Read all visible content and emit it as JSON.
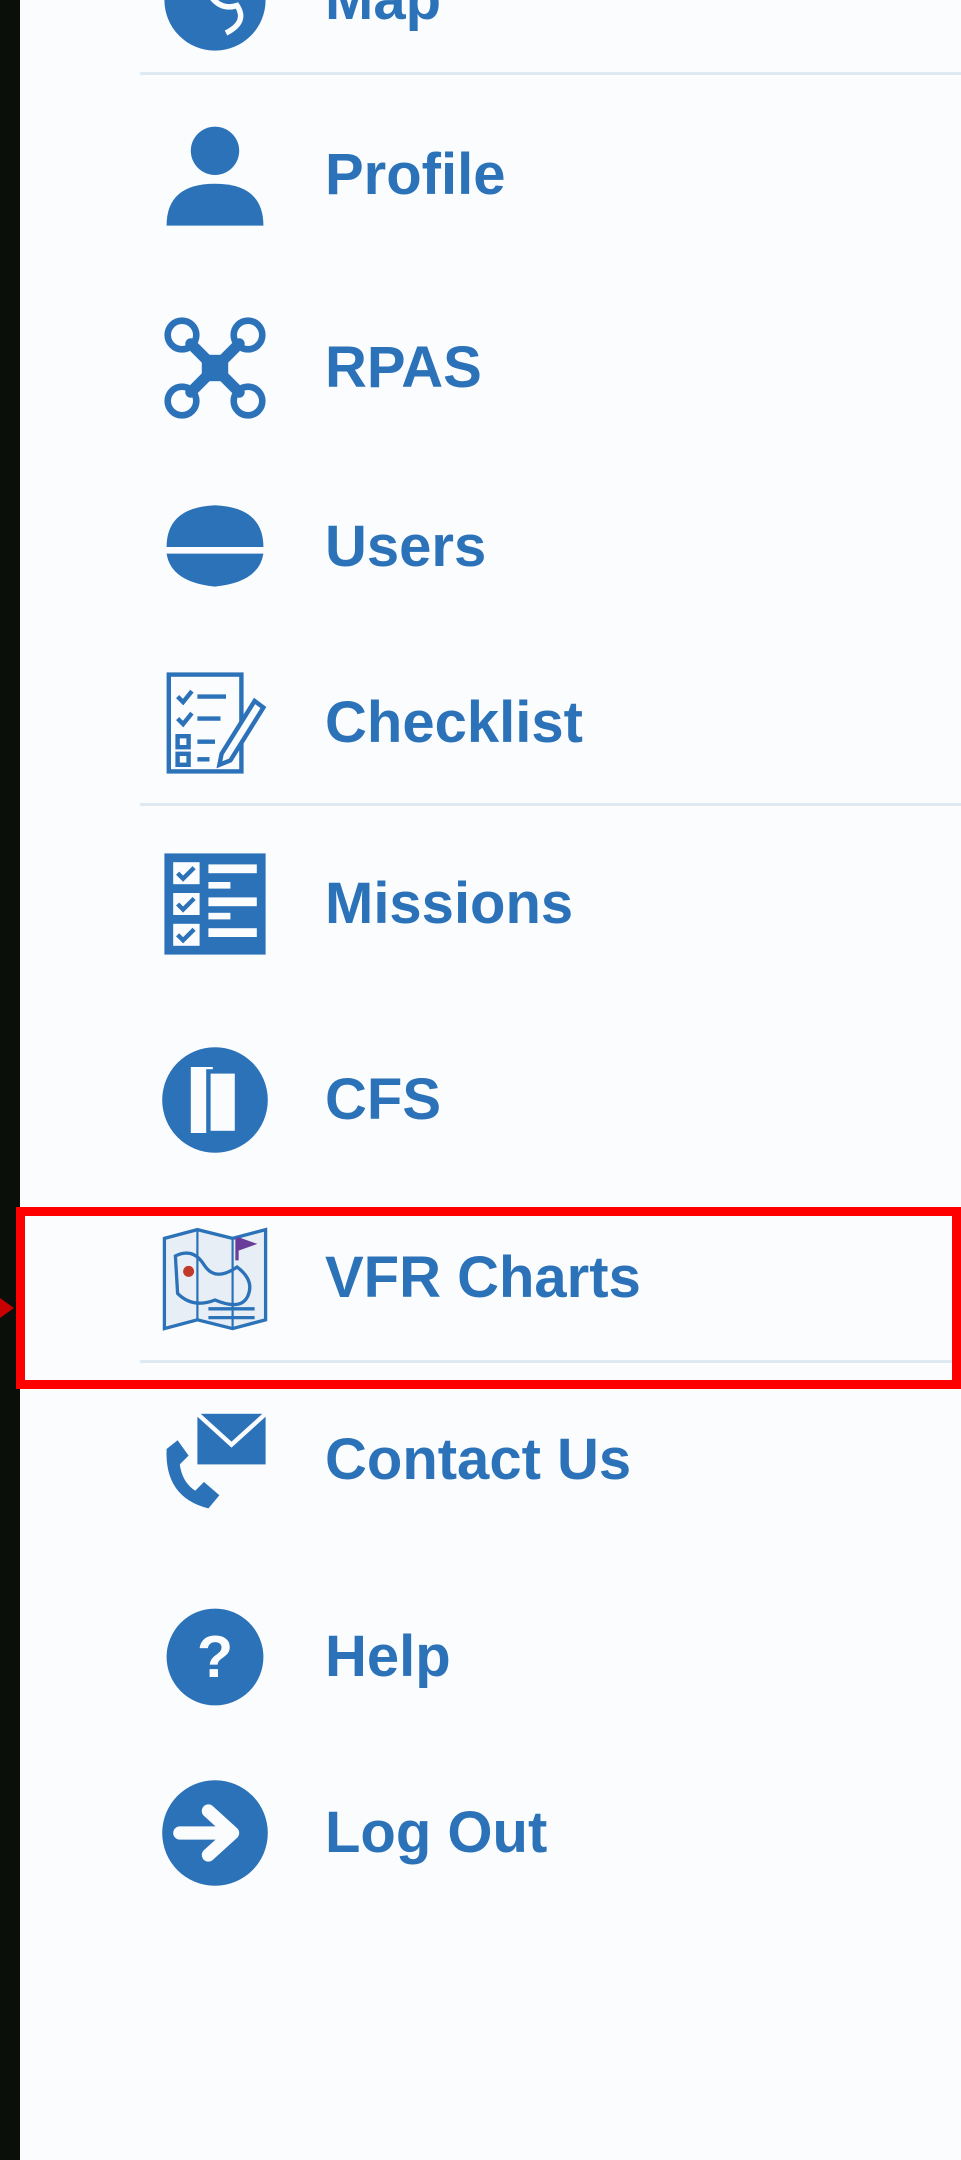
{
  "menu": {
    "items": [
      {
        "label": "Map",
        "icon": "globe-icon"
      },
      {
        "label": "Profile",
        "icon": "person-icon"
      },
      {
        "label": "RPAS",
        "icon": "drone-icon"
      },
      {
        "label": "Users",
        "icon": "pilot-cap-icon"
      },
      {
        "label": "Checklist",
        "icon": "checklist-icon"
      },
      {
        "label": "Missions",
        "icon": "missions-list-icon"
      },
      {
        "label": "CFS",
        "icon": "book-icon"
      },
      {
        "label": "VFR Charts",
        "icon": "chart-map-icon"
      },
      {
        "label": "Contact Us",
        "icon": "phone-mail-icon"
      },
      {
        "label": "Help",
        "icon": "question-icon"
      },
      {
        "label": "Log Out",
        "icon": "logout-arrow-icon"
      }
    ],
    "highlighted_item": "VFR Charts"
  },
  "colors": {
    "accent": "#2b72b8",
    "label": "#2b72b8",
    "divider": "#dfe9f2",
    "highlight_border": "#ff0000",
    "background": "#fbfcfd"
  }
}
